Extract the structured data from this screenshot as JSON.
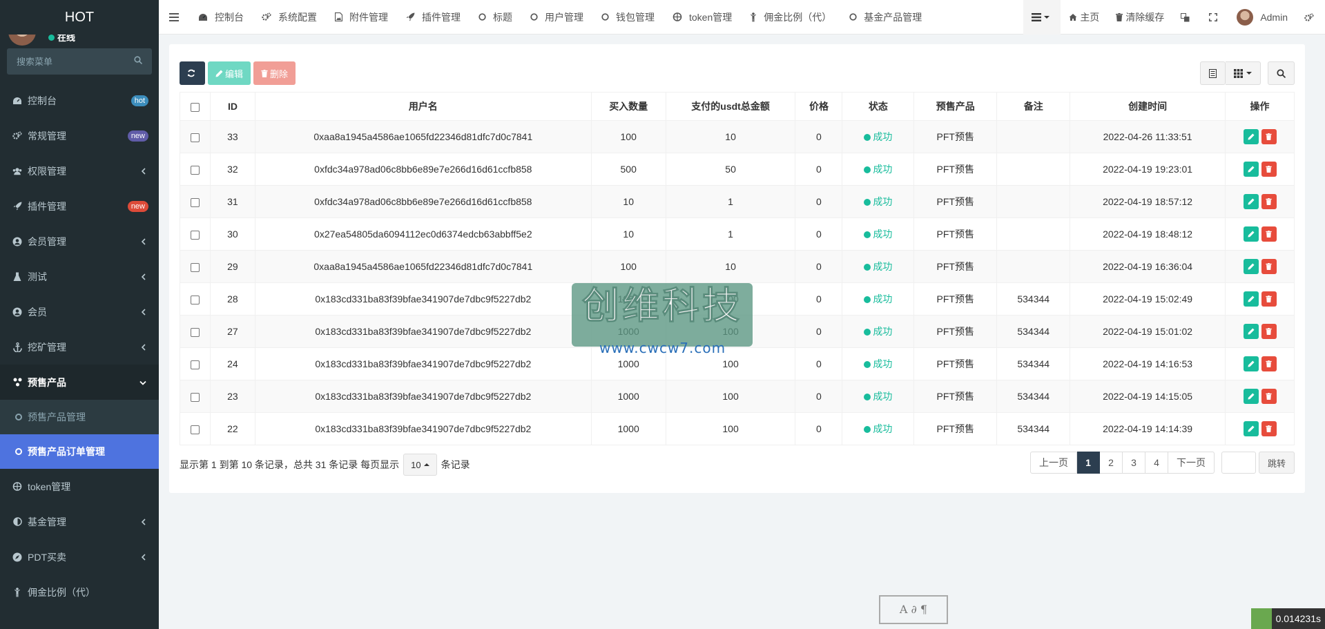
{
  "sidebar": {
    "logo": "HOT",
    "user_status": "在线",
    "search_placeholder": "搜索菜单",
    "items": [
      {
        "label": "控制台",
        "badge": "hot",
        "badge_color": "#3c8dbc"
      },
      {
        "label": "常规管理",
        "badge": "new",
        "badge_color": "#605ca8"
      },
      {
        "label": "权限管理",
        "chevron": true
      },
      {
        "label": "插件管理",
        "badge": "new",
        "badge_color": "#dd4b39"
      },
      {
        "label": "会员管理",
        "chevron": true
      },
      {
        "label": "测试",
        "chevron": true
      },
      {
        "label": "会员",
        "chevron": true
      },
      {
        "label": "挖矿管理",
        "chevron": true
      },
      {
        "label": "预售产品",
        "open": true
      }
    ],
    "submenu": [
      {
        "label": "预售产品管理"
      },
      {
        "label": "预售产品订单管理",
        "active": true
      }
    ],
    "items_after": [
      {
        "label": "token管理"
      },
      {
        "label": "基金管理",
        "chevron": true
      },
      {
        "label": "PDT买卖",
        "chevron": true
      },
      {
        "label": "佣金比例（代）"
      }
    ]
  },
  "topbar": {
    "tabs": [
      "控制台",
      "系统配置",
      "附件管理",
      "插件管理",
      "标题",
      "用户管理",
      "钱包管理",
      "token管理",
      "佣金比例（代）",
      "基金产品管理"
    ],
    "home": "主页",
    "clear_cache": "清除缓存",
    "user": "Admin"
  },
  "toolbar": {
    "edit": "编辑",
    "delete": "删除"
  },
  "table": {
    "headers": [
      "ID",
      "用户名",
      "买入数量",
      "支付的usdt总金额",
      "价格",
      "状态",
      "预售产品",
      "备注",
      "创建时间",
      "操作"
    ],
    "rows": [
      [
        "33",
        "0xaa8a1945a4586ae1065fd22346d81dfc7d0c7841",
        "100",
        "10",
        "0",
        "成功",
        "PFT预售",
        "",
        "2022-04-26 11:33:51"
      ],
      [
        "32",
        "0xfdc34a978ad06c8bb6e89e7e266d16d61ccfb858",
        "500",
        "50",
        "0",
        "成功",
        "PFT预售",
        "",
        "2022-04-19 19:23:01"
      ],
      [
        "31",
        "0xfdc34a978ad06c8bb6e89e7e266d16d61ccfb858",
        "10",
        "1",
        "0",
        "成功",
        "PFT预售",
        "",
        "2022-04-19 18:57:12"
      ],
      [
        "30",
        "0x27ea54805da6094112ec0d6374edcb63abbff5e2",
        "10",
        "1",
        "0",
        "成功",
        "PFT预售",
        "",
        "2022-04-19 18:48:12"
      ],
      [
        "29",
        "0xaa8a1945a4586ae1065fd22346d81dfc7d0c7841",
        "100",
        "10",
        "0",
        "成功",
        "PFT预售",
        "",
        "2022-04-19 16:36:04"
      ],
      [
        "28",
        "0x183cd331ba83f39bfae341907de7dbc9f5227db2",
        "1000",
        "100",
        "0",
        "成功",
        "PFT预售",
        "534344",
        "2022-04-19 15:02:49"
      ],
      [
        "27",
        "0x183cd331ba83f39bfae341907de7dbc9f5227db2",
        "1000",
        "100",
        "0",
        "成功",
        "PFT预售",
        "534344",
        "2022-04-19 15:01:02"
      ],
      [
        "24",
        "0x183cd331ba83f39bfae341907de7dbc9f5227db2",
        "1000",
        "100",
        "0",
        "成功",
        "PFT预售",
        "534344",
        "2022-04-19 14:16:53"
      ],
      [
        "23",
        "0x183cd331ba83f39bfae341907de7dbc9f5227db2",
        "1000",
        "100",
        "0",
        "成功",
        "PFT预售",
        "534344",
        "2022-04-19 14:15:05"
      ],
      [
        "22",
        "0x183cd331ba83f39bfae341907de7dbc9f5227db2",
        "1000",
        "100",
        "0",
        "成功",
        "PFT预售",
        "534344",
        "2022-04-19 14:14:39"
      ]
    ]
  },
  "footer": {
    "info": "显示第 1 到第 10 条记录，总共 31 条记录 每页显示",
    "page_size": "10",
    "info_suffix": "条记录",
    "prev": "上一页",
    "pages": [
      "1",
      "2",
      "3",
      "4"
    ],
    "next": "下一页",
    "jump": "跳转"
  },
  "watermark": {
    "title": "创维科技",
    "url": "www.cwcw7.com"
  },
  "stamp": "A ∂ ¶",
  "timer": "0.014231s"
}
